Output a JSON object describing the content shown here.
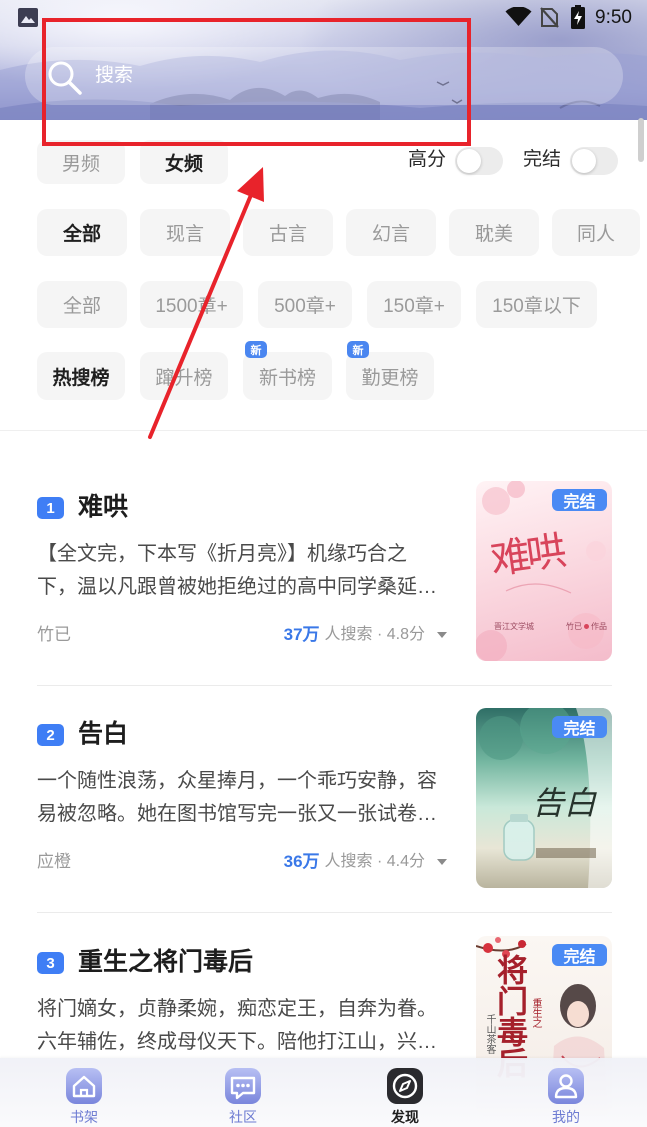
{
  "status_bar": {
    "time": "9:50",
    "icons": [
      "gallery-icon",
      "wifi-icon",
      "no-sim-icon",
      "battery-charging-icon"
    ]
  },
  "search": {
    "placeholder": "搜索",
    "icon": "search-icon"
  },
  "filters": {
    "gender": [
      {
        "label": "男频",
        "selected": false
      },
      {
        "label": "女频",
        "selected": true
      }
    ],
    "toggles": [
      {
        "label": "高分",
        "on": false
      },
      {
        "label": "完结",
        "on": false
      }
    ],
    "categories": [
      {
        "label": "全部",
        "selected": true
      },
      {
        "label": "现言",
        "selected": false
      },
      {
        "label": "古言",
        "selected": false
      },
      {
        "label": "幻言",
        "selected": false
      },
      {
        "label": "耽美",
        "selected": false
      },
      {
        "label": "同人",
        "selected": false
      }
    ],
    "lengths": [
      {
        "label": "全部",
        "selected": false
      },
      {
        "label": "1500章+",
        "selected": false
      },
      {
        "label": "500章+",
        "selected": false
      },
      {
        "label": "150章+",
        "selected": false
      },
      {
        "label": "150章以下",
        "selected": false
      }
    ],
    "rankings": [
      {
        "label": "热搜榜",
        "selected": true
      },
      {
        "label": "蹿升榜",
        "selected": false
      },
      {
        "label": "新书榜",
        "selected": false,
        "badge": "新"
      },
      {
        "label": "勤更榜",
        "selected": false,
        "badge": "新"
      }
    ]
  },
  "books": [
    {
      "rank": "1",
      "title": "难哄",
      "desc_lines": [
        "【全文完，下本写《折月亮》】机缘巧合之",
        "下，温以凡跟曾被她拒绝过的高中同学桑延…"
      ],
      "author": "竹已",
      "search_count": "37万",
      "search_label": "人搜索 · 4.8分",
      "status": "完结",
      "cover": {
        "title": "难哄",
        "publisher": "晋江文学城",
        "credit_name": "竹已",
        "credit_suffix": "作品"
      }
    },
    {
      "rank": "2",
      "title": "告白",
      "desc_lines": [
        "一个随性浪荡，众星捧月，一个乖巧安静，容",
        "易被忽略。她在图书馆写完一张又一张试卷…"
      ],
      "author": "应橙",
      "search_count": "36万",
      "search_label": "人搜索 · 4.4分",
      "status": "完结",
      "cover": {
        "title": "告白"
      }
    },
    {
      "rank": "3",
      "title": "重生之将门毒后",
      "desc_lines": [
        "将门嫡女，贞静柔婉，痴恋定王，自奔为眷。",
        "六年辅佐，终成母仪天下。陪他打江山，兴…"
      ],
      "status": "完结",
      "cover": {
        "title": "将门毒后",
        "prefix": "重生之",
        "author": "千山茶客"
      }
    }
  ],
  "nav": [
    {
      "label": "书架",
      "icon": "bookshelf-house-icon",
      "selected": false
    },
    {
      "label": "社区",
      "icon": "community-chat-icon",
      "selected": false
    },
    {
      "label": "发现",
      "icon": "discover-compass-icon",
      "selected": true
    },
    {
      "label": "我的",
      "icon": "profile-person-icon",
      "selected": false
    }
  ],
  "colors": {
    "accent": "#3f7ef5",
    "completed_badge": "#4a8af4",
    "nav_inactive": "#6d7bd2",
    "nav_active": "#1f1f1f",
    "annotation": "#e8232b"
  }
}
